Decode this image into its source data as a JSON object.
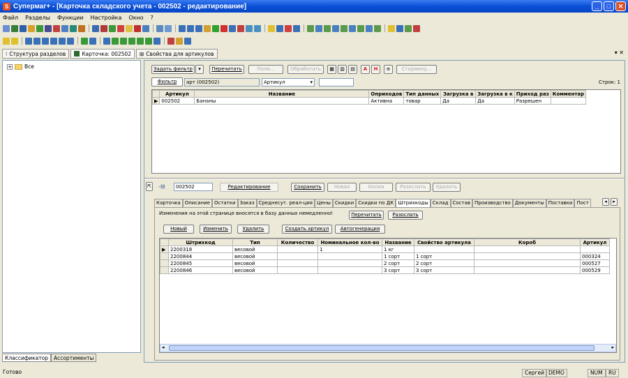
{
  "window": {
    "title": "Супермаг+  - [Карточка складского учета - 002502 - редактирование]",
    "min": "_",
    "max": "□",
    "close": "✕"
  },
  "menu": [
    "Файл",
    "Разделы",
    "Функции",
    "Настройка",
    "Окно",
    "?"
  ],
  "doctabs": [
    {
      "label": "Структура разделов"
    },
    {
      "label": "Карточка: 002502"
    },
    {
      "label": "Свойства для артикулов"
    }
  ],
  "left": {
    "tree_root": "Все",
    "tabs": [
      "Классификатор",
      "Ассортименты"
    ]
  },
  "filterbar": {
    "set_filter": "Задать фильтр",
    "reread": "Перечитать",
    "fields": "Поля...",
    "process": "Обработать",
    "stormenu": "Стормену...",
    "rows": "Строк: 1"
  },
  "filter": {
    "tab": "Фильтр",
    "value": "арт (002502)",
    "field": "Артикул"
  },
  "top_grid": {
    "columns": [
      "Артикул",
      "Название",
      "Оприходов",
      "Тип данных",
      "Загрузка в",
      "Загрузка в к",
      "Приход раз",
      "Комментар"
    ],
    "row": [
      "002502",
      "Бананы",
      "Активна",
      "товар",
      "Да",
      "Да",
      "Разрешен",
      ""
    ]
  },
  "editbar": {
    "code": "002502",
    "mode": "Редактирование",
    "save": "Сохранить",
    "new": "Новая",
    "copy": "Копия",
    "send": "Разослать",
    "delete": "Удалить"
  },
  "tabs": [
    "Карточка",
    "Описание",
    "Остатки",
    "Заказ",
    "Среднесут. реал-ция",
    "Цены",
    "Скидки",
    "Скидки по ДК",
    "Штрихкоды",
    "Склад",
    "Состав",
    "Производство",
    "Документы",
    "Поставки",
    "Пост"
  ],
  "notice": "Изменения на этой странице вносятся в базу данных немедленно!",
  "barcode_buttons": {
    "reread": "Перечитать",
    "send": "Разослать",
    "new": "Новый",
    "edit": "Изменить",
    "delete": "Удалить",
    "create": "Создать артикул",
    "autogen": "Автогенерация"
  },
  "barcode_grid": {
    "columns": [
      "Штрихкод",
      "Тип",
      "Количество",
      "Номинальное кол-во",
      "Название",
      "Свойство артикула",
      "Короб",
      "Артикул"
    ],
    "rows": [
      [
        "2200318",
        "весовой",
        "",
        "1",
        "1 кг",
        "",
        "",
        ""
      ],
      [
        "2200844",
        "весовой",
        "",
        "",
        "1 сорт",
        "1 сорт",
        "",
        "000324"
      ],
      [
        "2200845",
        "весовой",
        "",
        "",
        "2 сорт",
        "2 сорт",
        "",
        "000527"
      ],
      [
        "2200846",
        "весовой",
        "",
        "",
        "3 сорт",
        "3 сорт",
        "",
        "000529"
      ]
    ]
  },
  "status": {
    "ready": "Готово",
    "user": "Сергей",
    "db": "DEMO",
    "num": "NUM",
    "lang": "RU"
  }
}
